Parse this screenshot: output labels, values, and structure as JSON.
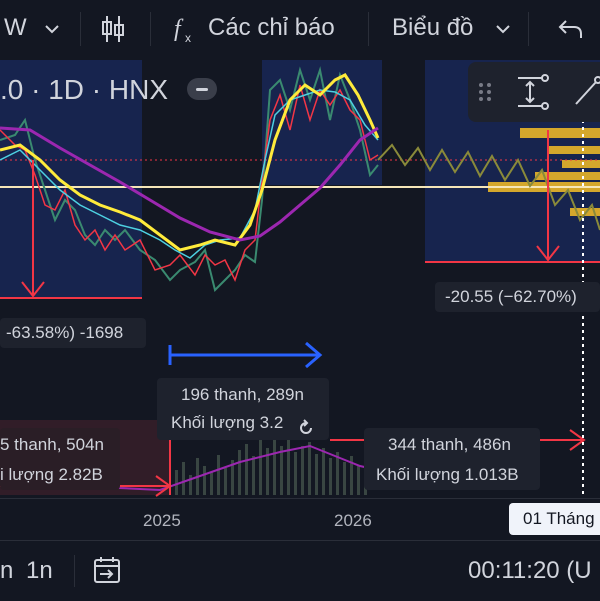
{
  "toolbar": {
    "symbol_partial": "W",
    "indicators_label": "Các chỉ báo",
    "chart_type_label": "Biểu đồ"
  },
  "legend": {
    "symbol_info": ".0 · 1D · HNX"
  },
  "measurements": {
    "left_pct": "-63.58%) -1698",
    "right_pct": "-20.55 (−62.70%)",
    "middle_bars": "196 thanh, 289n",
    "middle_volume": "Khối lượng 3.2",
    "left_bars": "5 thanh, 504n",
    "left_volume": "i lượng 2.82B",
    "right_bars": "344 thanh, 486n",
    "right_volume": "Khối lượng 1.013B"
  },
  "date_axis": {
    "labels": [
      "2025",
      "2026"
    ],
    "crosshair_date": "01 Tháng"
  },
  "bottom_bar": {
    "interval_a": "n",
    "interval_b": "1n",
    "clock": "00:11:20 (U"
  },
  "colors": {
    "background": "#131722",
    "measure_red": "#f23645",
    "measure_blue": "#2962ff",
    "ma_yellow": "#ffeb3b",
    "ma_purple": "#9c27b0",
    "horizontal_line": "#f5e6b8",
    "volume_profile": "#d4a72c"
  }
}
